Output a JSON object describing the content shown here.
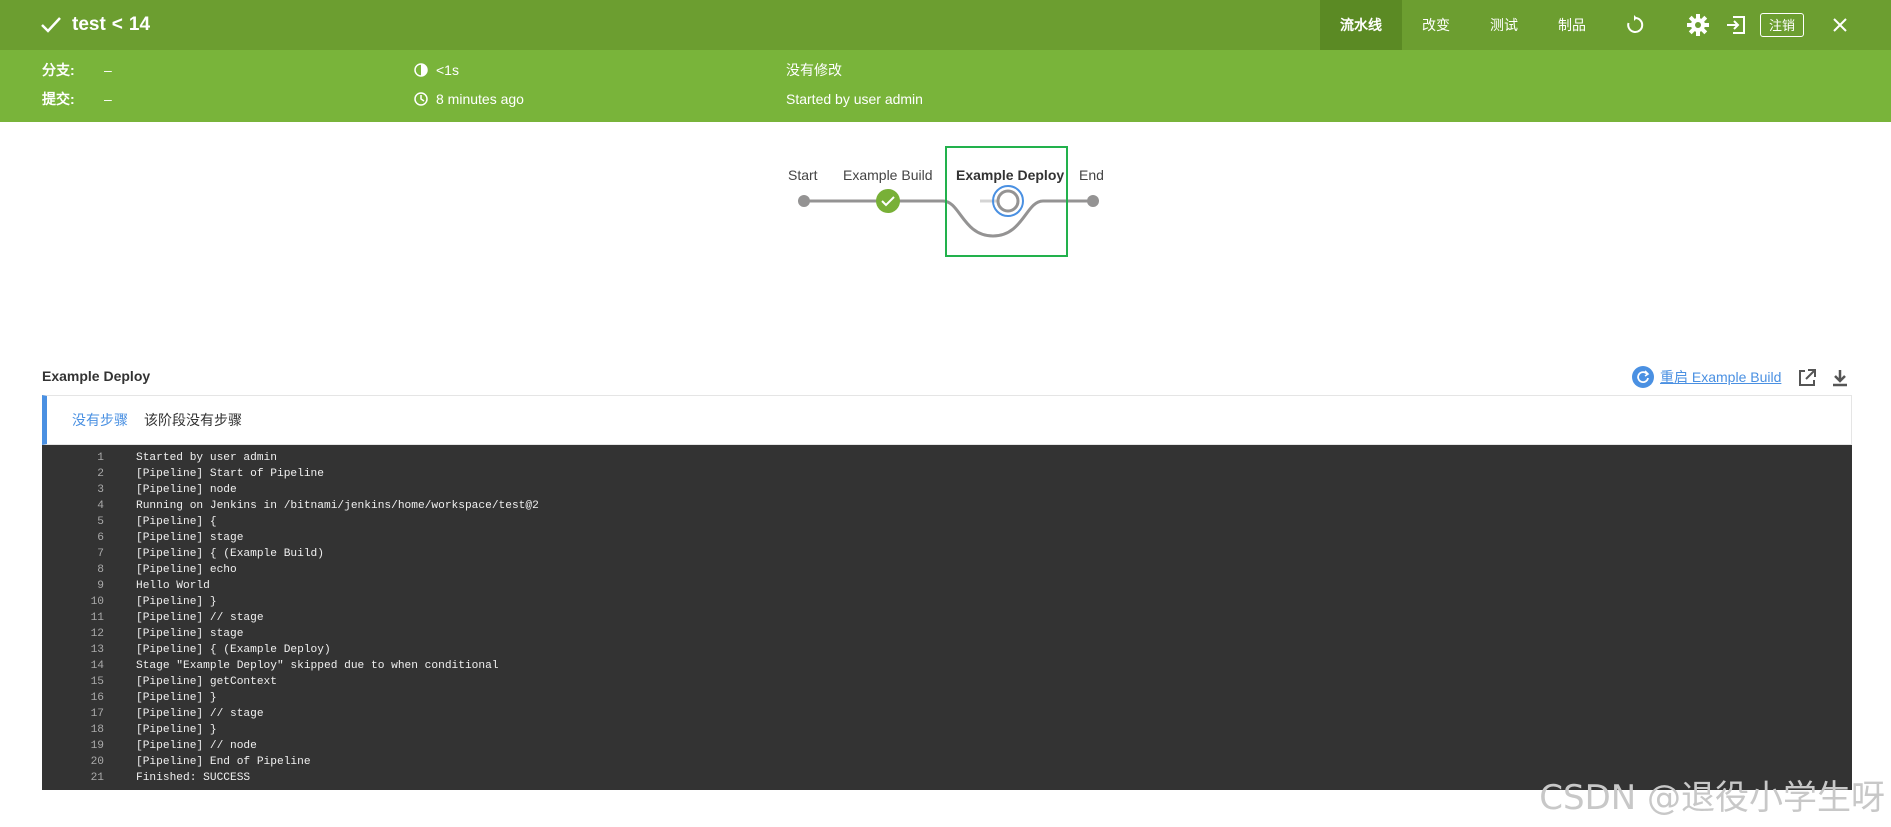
{
  "header": {
    "title": "test",
    "separator": "<",
    "run_number": "14",
    "tabs": [
      {
        "label": "流水线",
        "active": true
      },
      {
        "label": "改变",
        "active": false
      },
      {
        "label": "测试",
        "active": false
      },
      {
        "label": "制品",
        "active": false
      }
    ],
    "logout_label": "注销"
  },
  "info": {
    "branch_label": "分支:",
    "branch_value": "–",
    "commit_label": "提交:",
    "commit_value": "–",
    "duration": "<1s",
    "started_ago": "8 minutes ago",
    "changes": "没有修改",
    "started_by": "Started by user admin"
  },
  "pipeline": {
    "stages": [
      {
        "name": "Start",
        "status": "start"
      },
      {
        "name": "Example Build",
        "status": "success"
      },
      {
        "name": "Example Deploy",
        "status": "skipped",
        "selected": true
      },
      {
        "name": "End",
        "status": "end"
      }
    ]
  },
  "details": {
    "stage_title": "Example Deploy",
    "restart_label": "重启 Example Build",
    "no_steps_title": "没有步骤",
    "no_steps_desc": "该阶段没有步骤"
  },
  "console": {
    "lines": [
      "Started by user admin",
      "[Pipeline] Start of Pipeline",
      "[Pipeline] node",
      "Running on Jenkins in /bitnami/jenkins/home/workspace/test@2",
      "[Pipeline] {",
      "[Pipeline] stage",
      "[Pipeline] { (Example Build)",
      "[Pipeline] echo",
      "Hello World",
      "[Pipeline] }",
      "[Pipeline] // stage",
      "[Pipeline] stage",
      "[Pipeline] { (Example Deploy)",
      "Stage \"Example Deploy\" skipped due to when conditional",
      "[Pipeline] getContext",
      "[Pipeline] }",
      "[Pipeline] // stage",
      "[Pipeline] }",
      "[Pipeline] // node",
      "[Pipeline] End of Pipeline",
      "Finished: SUCCESS"
    ]
  },
  "watermark": "CSDN @退役小学生呀",
  "colors": {
    "topbar": "#6c9e30",
    "infobar": "#79b43a",
    "accent": "#4a90e2",
    "success": "#78b037",
    "console_bg": "#333333",
    "highlight": "#22b14c"
  }
}
